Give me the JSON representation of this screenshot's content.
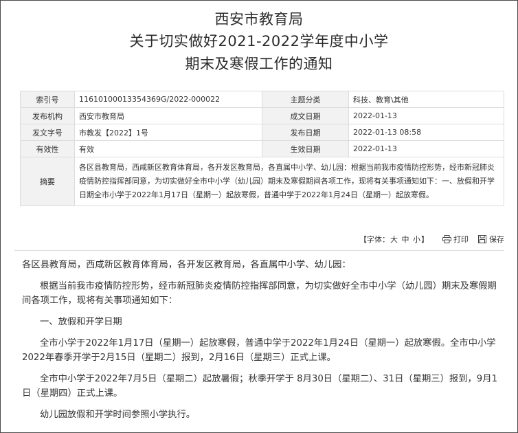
{
  "header": {
    "title_line1": "西安市教育局",
    "title_line2": "关于切实做好2021-2022学年度中小学",
    "title_line3": "期末及寒假工作的通知"
  },
  "meta": {
    "index_label": "索引号",
    "index_value": "11610100013354369G/2022-000022",
    "topic_label": "主题分类",
    "topic_value": "科技、教育\\其他",
    "publisher_label": "发布机构",
    "publisher_value": "西安市教育局",
    "created_label": "成文日期",
    "created_value": "2022-01-13",
    "docno_label": "发文字号",
    "docno_value": "市教发【2022】1号",
    "pubdate_label": "发布日期",
    "pubdate_value": "2022-01-13 08:58",
    "validity_label": "有效性",
    "validity_value": "有效",
    "effective_label": "生效日期",
    "effective_value": "2022-01-13",
    "abstract_label": "摘要",
    "abstract_value": "各区县教育局，西咸新区教育体育局，各开发区教育局，各直属中小学、幼儿园：根据当前我市疫情防控形势，经市新冠肺炎疫情防控指挥部同意，为切实做好全市中小学（幼儿园）期末及寒假期间各项工作，现将有关事项通知如下：一、放假和开学日期全市小学于2022年1月17日（星期一）起放寒假，普通中学于2022年1月24日（星期一）起放寒假。"
  },
  "toolbar": {
    "font_label": "【字体：",
    "font_large": "大",
    "font_medium": "中",
    "font_small": "小",
    "font_close": "】",
    "print_label": "打印",
    "save_label": "保存"
  },
  "content": {
    "salutation": "各区县教育局，西咸新区教育体育局，各开发区教育局，各直属中小学、幼儿园：",
    "p1": "根据当前我市疫情防控形势，经市新冠肺炎疫情防控指挥部同意，为切实做好全市中小学（幼儿园）期末及寒假期间各项工作，现将有关事项通知如下：",
    "section1": "一、放假和开学日期",
    "p2": "全市小学于2022年1月17日（星期一）起放寒假，普通中学于2022年1月24日（星期一）起放寒假。全市中小学2022年春季开学于2月15日（星期二）报到，2月16日（星期三）正式上课。",
    "p3": "全市中小学于2022年7月5日（星期二）起放暑假；秋季开学于 8月30日（星期二）、31日（星期三）报到，9月1日（星期四）正式上课。",
    "p4": "幼儿园放假和开学时间参照小学执行。"
  }
}
